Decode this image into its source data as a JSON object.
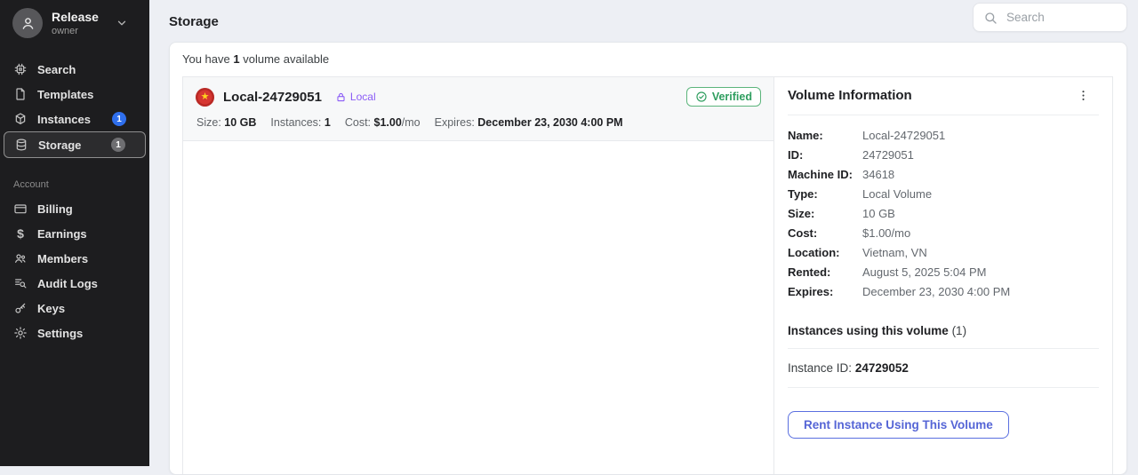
{
  "page_title": "Storage",
  "search": {
    "placeholder": "Search"
  },
  "sidebar": {
    "workspace": {
      "name": "Release",
      "role": "owner"
    },
    "items": [
      {
        "label": "Search",
        "icon": "chip-icon"
      },
      {
        "label": "Templates",
        "icon": "document-icon"
      },
      {
        "label": "Instances",
        "icon": "cube-icon",
        "badge": "1"
      },
      {
        "label": "Storage",
        "icon": "database-icon",
        "badge": "1",
        "selected": true
      }
    ],
    "account_label": "Account",
    "account_items": [
      {
        "label": "Billing",
        "icon": "credit-card-icon"
      },
      {
        "label": "Earnings",
        "icon": "dollar-icon"
      },
      {
        "label": "Members",
        "icon": "people-icon"
      },
      {
        "label": "Audit Logs",
        "icon": "list-search-icon"
      },
      {
        "label": "Keys",
        "icon": "key-icon"
      },
      {
        "label": "Settings",
        "icon": "gear-icon"
      }
    ]
  },
  "volumes": {
    "summary": {
      "prefix": "You have",
      "count": "1",
      "suffix": "volume available"
    },
    "item": {
      "flag_icon": "vietnam-flag-icon",
      "name": "Local-24729051",
      "tag": "Local",
      "verified_label": "Verified",
      "details": [
        {
          "label": "Size:",
          "value": "10 GB",
          "suffix": ""
        },
        {
          "label": "Instances:",
          "value": "1",
          "suffix": ""
        },
        {
          "label": "Cost:",
          "value": "$1.00",
          "suffix": "/mo"
        },
        {
          "label": "Expires:",
          "value": "December 23, 2030 4:00 PM",
          "suffix": ""
        }
      ]
    }
  },
  "info_panel": {
    "title": "Volume Information",
    "fields": [
      {
        "label": "Name:",
        "value": "Local-24729051"
      },
      {
        "label": "ID:",
        "value": "24729051"
      },
      {
        "label": "Machine ID:",
        "value": "34618"
      },
      {
        "label": "Type:",
        "value": "Local Volume"
      },
      {
        "label": "Size:",
        "value": "10 GB"
      },
      {
        "label": "Cost:",
        "value": "$1.00/mo"
      },
      {
        "label": "Location:",
        "value": "Vietnam, VN"
      },
      {
        "label": "Rented:",
        "value": "August 5, 2025 5:04 PM"
      },
      {
        "label": "Expires:",
        "value": "December 23, 2030 4:00 PM"
      }
    ],
    "instances_heading": "Instances using this volume",
    "instances_count": "(1)",
    "instance_row": {
      "label": "Instance ID:",
      "value": "24729052"
    },
    "rent_button": "Rent Instance Using This Volume"
  },
  "colors": {
    "sidebar_bg": "#1d1d1f",
    "badge_blue": "#2f6fed",
    "badge_gray": "#6e6e71",
    "local_tag_purple": "#8b5cf6",
    "verified_green": "#2f9e5f",
    "flag_red": "#d63631",
    "flag_star_yellow": "#ffd21e",
    "button_indigo": "#5a6fe0",
    "page_bg": "#edeff4"
  }
}
